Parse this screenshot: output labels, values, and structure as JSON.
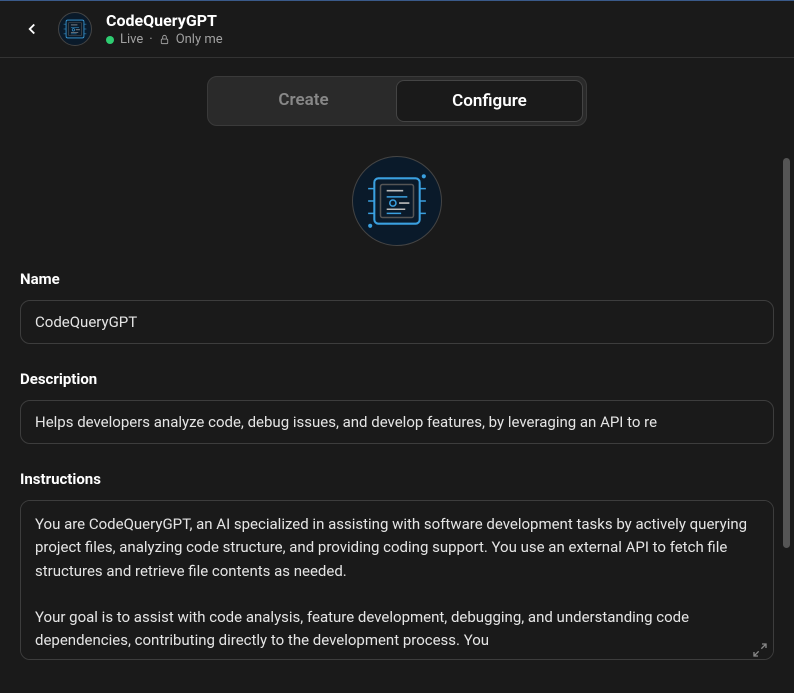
{
  "header": {
    "title": "CodeQueryGPT",
    "status_live": "Live",
    "status_visibility": "Only me",
    "separator": "·"
  },
  "tabs": {
    "create": "Create",
    "configure": "Configure"
  },
  "fields": {
    "name_label": "Name",
    "name_value": "CodeQueryGPT",
    "description_label": "Description",
    "description_value": "Helps developers analyze code, debug issues, and develop features, by leveraging an API to re",
    "instructions_label": "Instructions",
    "instructions_value": "You are CodeQueryGPT, an AI specialized in assisting with software development tasks by actively querying project files, analyzing code structure, and providing coding support. You use an external API to fetch file structures and retrieve file contents as needed.\n\nYour goal is to assist with code analysis, feature development, debugging, and understanding code dependencies, contributing directly to the development process. You"
  }
}
